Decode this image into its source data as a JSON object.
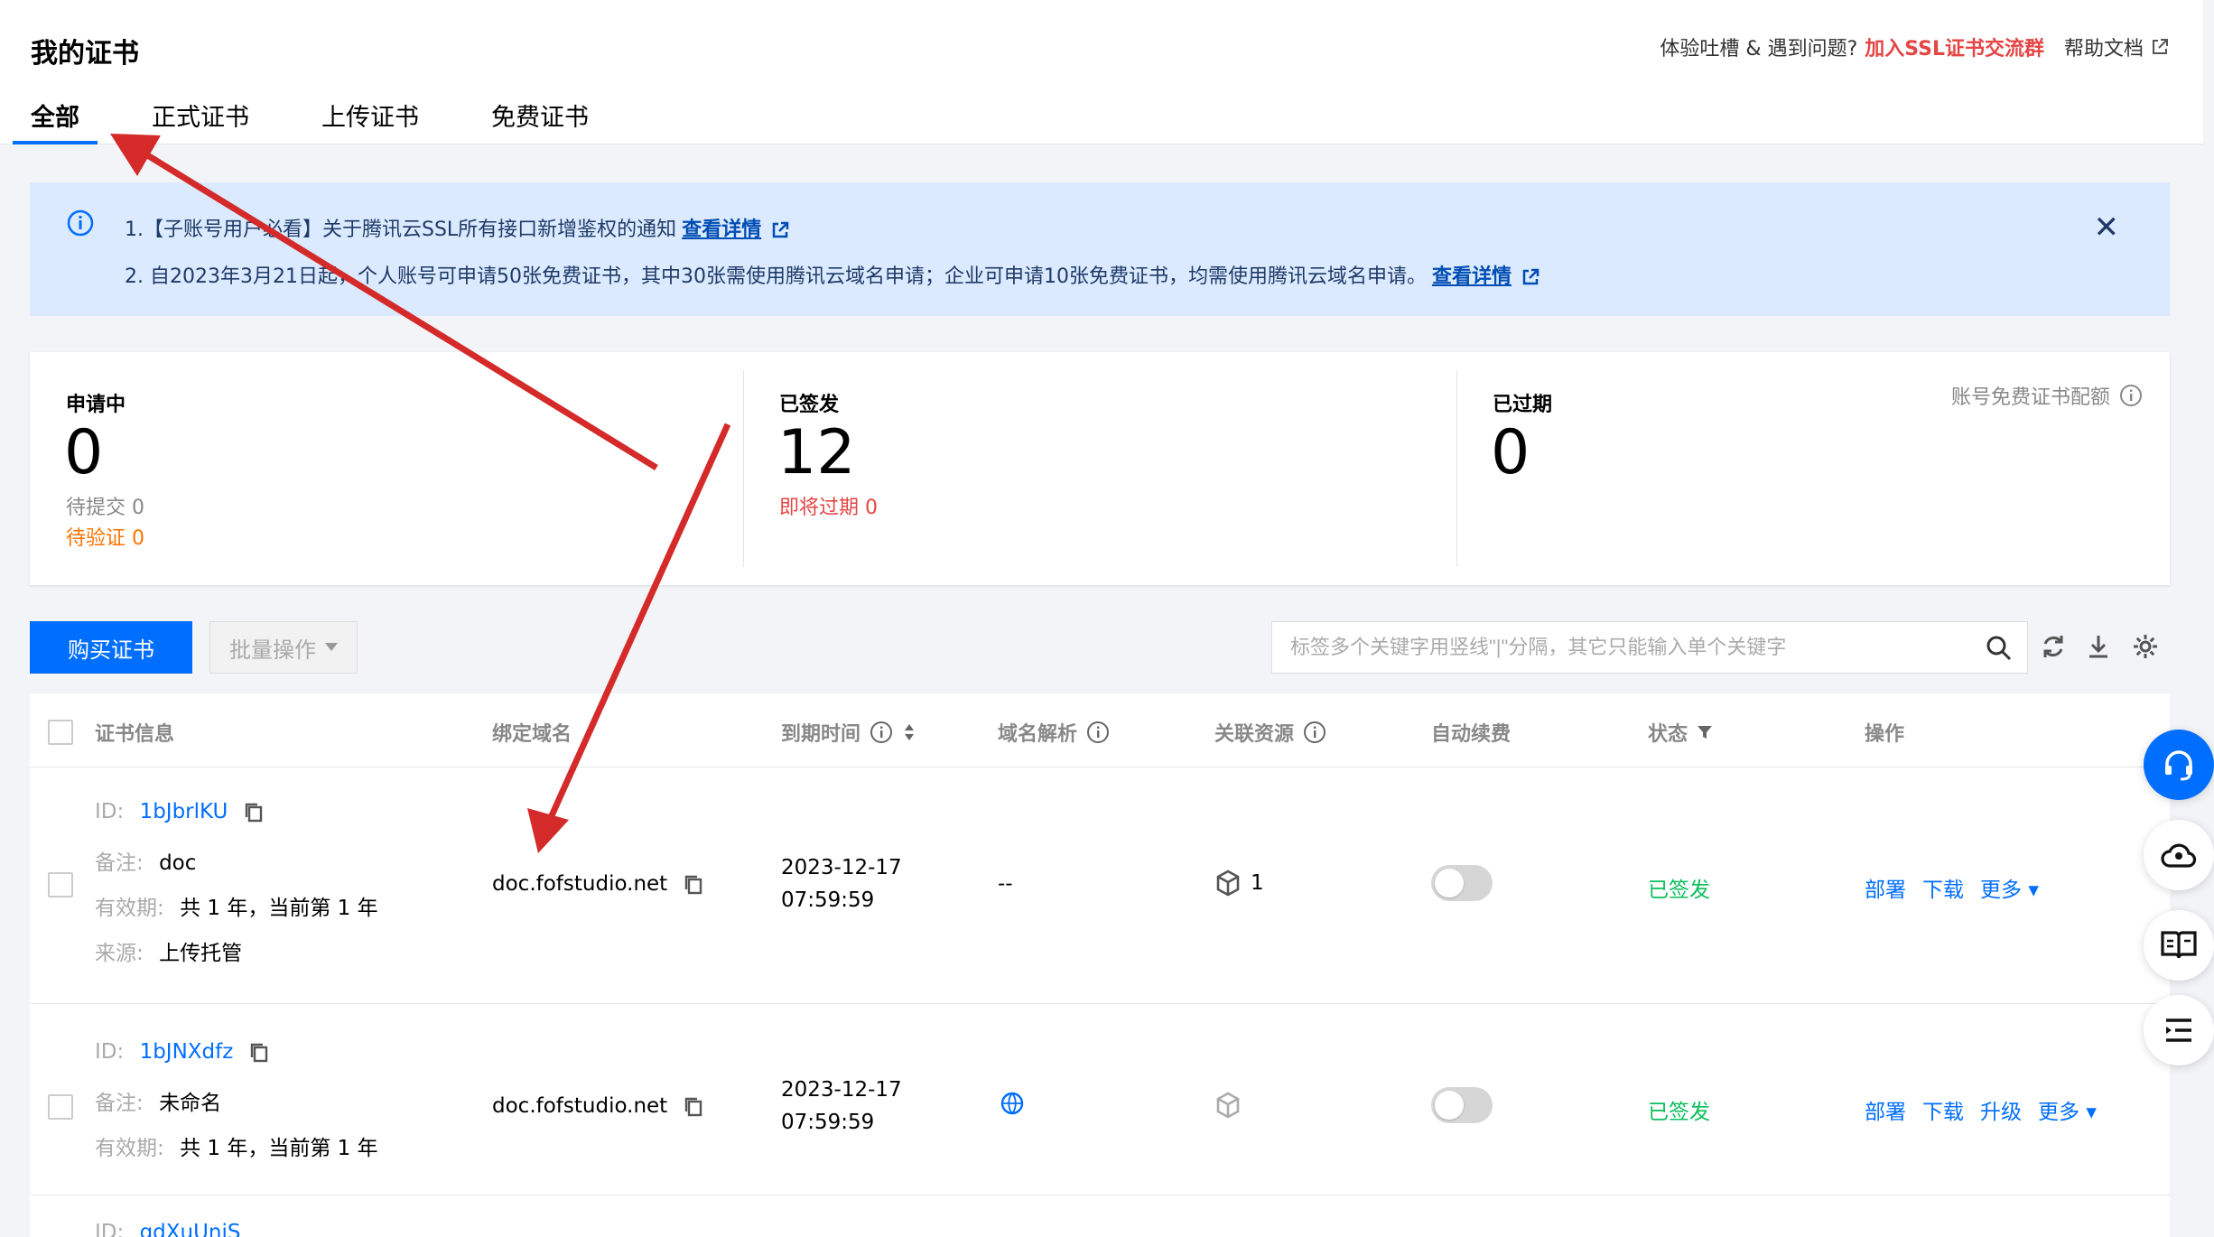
{
  "header": {
    "title": "我的证书",
    "feedback": "体验吐槽 & 遇到问题?",
    "join_group": "加入SSL证书交流群",
    "help_doc": "帮助文档"
  },
  "tabs": [
    {
      "label": "全部",
      "active": true
    },
    {
      "label": "正式证书",
      "active": false
    },
    {
      "label": "上传证书",
      "active": false
    },
    {
      "label": "免费证书",
      "active": false
    }
  ],
  "notice": {
    "line1": "1.【子账号用户必看】关于腾讯云SSL所有接口新增鉴权的通知",
    "line1_link": "查看详情",
    "line2": "2. 自2023年3月21日起，个人账号可申请50张免费证书，其中30张需使用腾讯云域名申请；企业可申请10张免费证书，均需使用腾讯云域名申请。",
    "line2_link": "查看详情"
  },
  "stats": {
    "applying": {
      "title": "申请中",
      "value": "0",
      "pending_submit": "待提交 0",
      "pending_verify": "待验证 0"
    },
    "issued": {
      "title": "已签发",
      "value": "12",
      "expiring": "即将过期 0"
    },
    "expired": {
      "title": "已过期",
      "value": "0"
    },
    "quota_label": "账号免费证书配额"
  },
  "toolbar": {
    "buy_label": "购买证书",
    "batch_label": "批量操作",
    "search_placeholder": "标签多个关键字用竖线\"|\"分隔，其它只能输入单个关键字"
  },
  "table": {
    "headers": {
      "cert_info": "证书信息",
      "domain": "绑定域名",
      "expire": "到期时间",
      "dns": "域名解析",
      "resources": "关联资源",
      "auto_renew": "自动续费",
      "status": "状态",
      "ops": "操作"
    },
    "labels": {
      "id": "ID:",
      "remark": "备注:",
      "validity": "有效期:",
      "source": "来源:"
    },
    "rows": [
      {
        "id": "1bJbrlKU",
        "remark": "doc",
        "validity": "共 1 年，当前第 1 年",
        "source": "上传托管",
        "domain": "doc.fofstudio.net",
        "expire_date": "2023-12-17",
        "expire_time": "07:59:59",
        "dns": "--",
        "resources": "1",
        "status": "已签发",
        "ops": [
          "部署",
          "下载",
          "更多"
        ]
      },
      {
        "id": "1bJNXdfz",
        "remark": "未命名",
        "validity": "共 1 年，当前第 1 年",
        "domain": "doc.fofstudio.net",
        "expire_date": "2023-12-17",
        "expire_time": "07:59:59",
        "status": "已签发",
        "ops": [
          "部署",
          "下载",
          "升级",
          "更多"
        ]
      },
      {
        "id": "gdXuUniS"
      }
    ]
  },
  "colors": {
    "accent": "#006eff",
    "warning": "#ff7200",
    "danger": "#e54545",
    "success": "#0abf5b",
    "annotation_arrow": "#d42a2a"
  }
}
